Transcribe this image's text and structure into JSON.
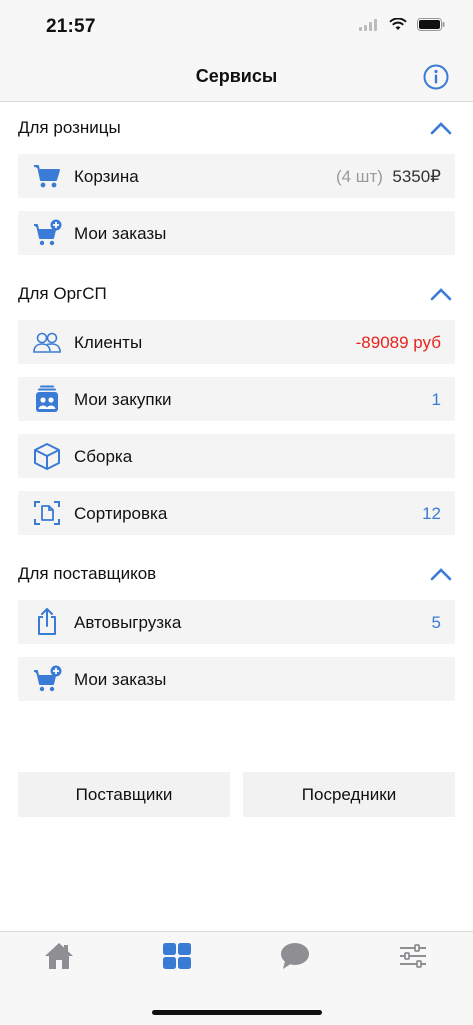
{
  "status": {
    "time": "21:57"
  },
  "nav": {
    "title": "Сервисы"
  },
  "sections": {
    "retail": {
      "title": "Для розницы",
      "cart": {
        "label": "Корзина",
        "count": "(4 шт)",
        "amount": "5350₽"
      },
      "orders": {
        "label": "Мои заказы"
      }
    },
    "orgsp": {
      "title": "Для ОргСП",
      "clients": {
        "label": "Клиенты",
        "value": "-89089 руб"
      },
      "purchases": {
        "label": "Мои закупки",
        "value": "1"
      },
      "assembly": {
        "label": "Сборка"
      },
      "sorting": {
        "label": "Сортировка",
        "value": "12"
      }
    },
    "suppliers": {
      "title": "Для поставщиков",
      "autoupload": {
        "label": "Автовыгрузка",
        "value": "5"
      },
      "orders": {
        "label": "Мои заказы"
      }
    }
  },
  "buttons": {
    "suppliers": "Поставщики",
    "intermediaries": "Посредники"
  },
  "colors": {
    "accent": "#3a7bd5",
    "negative": "#e8231c",
    "tab_inactive": "#8e8e93"
  },
  "tabs": [
    {
      "icon": "home-icon",
      "active": false
    },
    {
      "icon": "grid-icon",
      "active": true
    },
    {
      "icon": "chat-icon",
      "active": false
    },
    {
      "icon": "sliders-icon",
      "active": false
    }
  ]
}
